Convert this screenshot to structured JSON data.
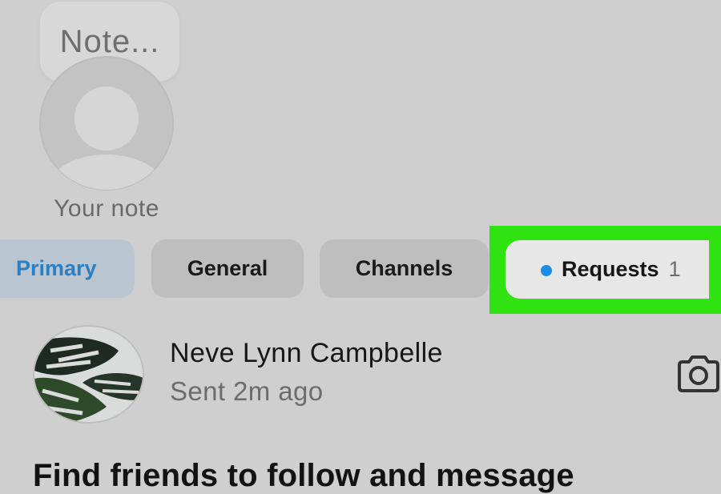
{
  "note": {
    "bubble_text": "Note...",
    "label": "Your note"
  },
  "tabs": [
    {
      "label": "Primary",
      "active": true
    },
    {
      "label": "General"
    },
    {
      "label": "Channels"
    },
    {
      "label": "Requests",
      "count": "1",
      "has_unread_dot": true
    }
  ],
  "messages": [
    {
      "name": "Neve Lynn Campbelle",
      "status": "Sent 2m ago",
      "action_icon": "camera-icon"
    }
  ],
  "find_friends": {
    "heading": "Find friends to follow and message"
  },
  "colors": {
    "highlight": "#2ee30f",
    "primary_tab_text": "#2a7fc4",
    "unread_dot": "#1a8ee8",
    "background": "#cfcfcf"
  }
}
